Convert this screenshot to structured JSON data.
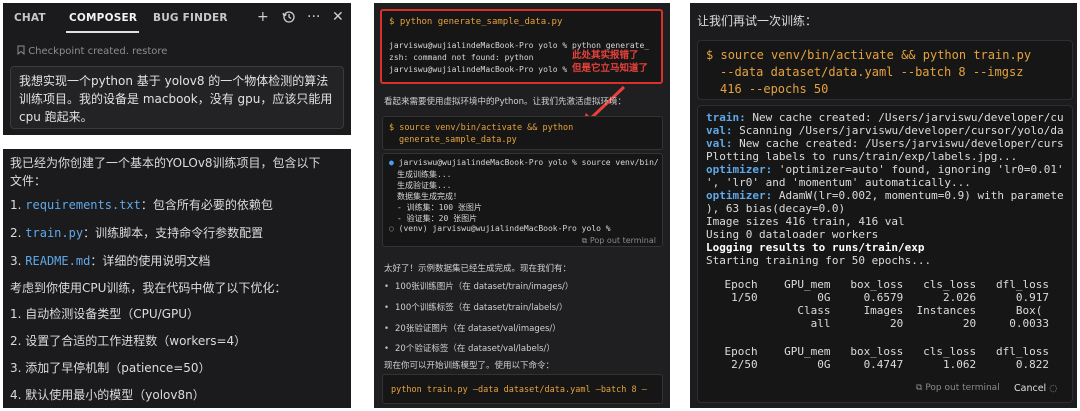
{
  "composer": {
    "tabs": [
      "CHAT",
      "COMPOSER",
      "BUG FINDER"
    ],
    "checkpoint_text": "Checkpoint created.",
    "restore_link": "restore",
    "user_message": "我想实现一个python 基于 yolov8 的一个物体检测的算法训练项目。我的设备是 macbook，没有 gpu，应该只能用 cpu 跑起来。"
  },
  "reply": {
    "intro_1": "我已经为你创建了一个基本的YOLOv8训练项目，包含以下",
    "intro_2": "文件：",
    "files": [
      {
        "num": "1.",
        "name": "requirements.txt",
        "desc": "：包含所有必要的依赖包"
      },
      {
        "num": "2.",
        "name": "train.py",
        "desc": "：训练脚本，支持命令行参数配置"
      },
      {
        "num": "3.",
        "name": "README.md",
        "desc": "：详细的使用说明文档"
      }
    ],
    "opt_intro": "考虑到你使用CPU训练，我在代码中做了以下优化：",
    "opts": [
      "1. 自动检测设备类型（CPU/GPU）",
      "2. 设置了合适的工作进程数（workers=4）",
      "3. 添加了早停机制（patience=50）",
      "4. 默认使用最小的模型（yolov8n）"
    ]
  },
  "terminal": {
    "cmd_1": "python generate_sample_data.py",
    "prompt_line_1": "jarviswu@wujialindeMacBook-Pro yolo % python generate_",
    "error_line": "zsh: command not found: python",
    "prompt_line_2": "jarviswu@wujialindeMacBook-Pro yolo %",
    "annotation_1": "此处其实报错了",
    "annotation_2": "但是它立马知道了",
    "venv_note": "看起来需要使用虚拟环境中的Python。让我们先激活虚拟环境：",
    "cmd_2a": "source venv/bin/activate && python",
    "cmd_2b": "generate_sample_data.py",
    "out_lines": [
      "jarviswu@wujialindeMacBook-Pro yolo % source venv/bin/",
      "生成训练集...",
      "生成验证集...",
      "数据集生成完成！",
      "- 训练集：100 张图片",
      "- 验证集：20 张图片",
      "(venv) jarviswu@wujialindeMacBook-Pro yolo %"
    ],
    "popout": "Pop out terminal",
    "done_note": "太好了！示例数据集已经生成完成。现在我们有：",
    "bullets": [
      "100张训练图片（在 dataset/train/images/）",
      "100个训练标签（在 dataset/train/labels/）",
      "20张验证图片（在 dataset/val/images/）",
      "20个验证标签（在 dataset/val/labels/）"
    ],
    "next_note": "现在你可以开始训练模型了。使用以下命令：",
    "train_cmd": "python train.py —data dataset/data.yaml —batch 8 —"
  },
  "training": {
    "title": "让我们再试一次训练：",
    "cmd_line_1": "source venv/bin/activate && python train.py",
    "cmd_line_2": "--data dataset/data.yaml --batch 8 --imgsz",
    "cmd_line_3": "416 --epochs 50",
    "log": [
      {
        "key": "train:",
        "text": " New cache created: /Users/jarviswu/developer/cu"
      },
      {
        "key": "val:",
        "text": " Scanning /Users/jarviswu/developer/cursor/yolo/da"
      },
      {
        "key": "val:",
        "text": " New cache created: /Users/jarviswu/developer/curs"
      },
      {
        "key": "",
        "text": "Plotting labels to runs/train/exp/labels.jpg..."
      },
      {
        "key": "optimizer:",
        "text": " 'optimizer=auto' found, ignoring 'lr0=0.01'"
      },
      {
        "key": "",
        "text": "', 'lr0' and 'momentum' automatically..."
      },
      {
        "key": "optimizer:",
        "text": " AdamW(lr=0.002, momentum=0.9) with paramete"
      },
      {
        "key": "",
        "text": "), 63 bias(decay=0.0)"
      },
      {
        "key": "",
        "text": "Image sizes 416 train, 416 val"
      },
      {
        "key": "",
        "text": "Using 0 dataloader workers"
      },
      {
        "key": "",
        "text": "Logging results to runs/train/exp"
      },
      {
        "key": "",
        "text": "Starting training for 50 epochs..."
      }
    ],
    "table1_head": "    Epoch    GPU_mem   box_loss   cls_loss   dfl_loss",
    "table1_row": "     1/50         0G     0.6579      2.026      0.917",
    "table1_sub_head": "               Class     Images  Instances      Box(",
    "table1_sub_row": "                 all         20         20     0.0033",
    "table2_head": "    Epoch    GPU_mem   box_loss   cls_loss   dfl_loss",
    "table2_row": "     2/50         0G     0.4747      1.062      0.822",
    "popout": "Pop out terminal",
    "cancel": "Cancel"
  },
  "colors": {
    "panel_bg": "#1b1b1d",
    "accent_blue": "#5fa8e8",
    "command_orange": "#e6a23c",
    "annotation_red": "#e8413a"
  }
}
